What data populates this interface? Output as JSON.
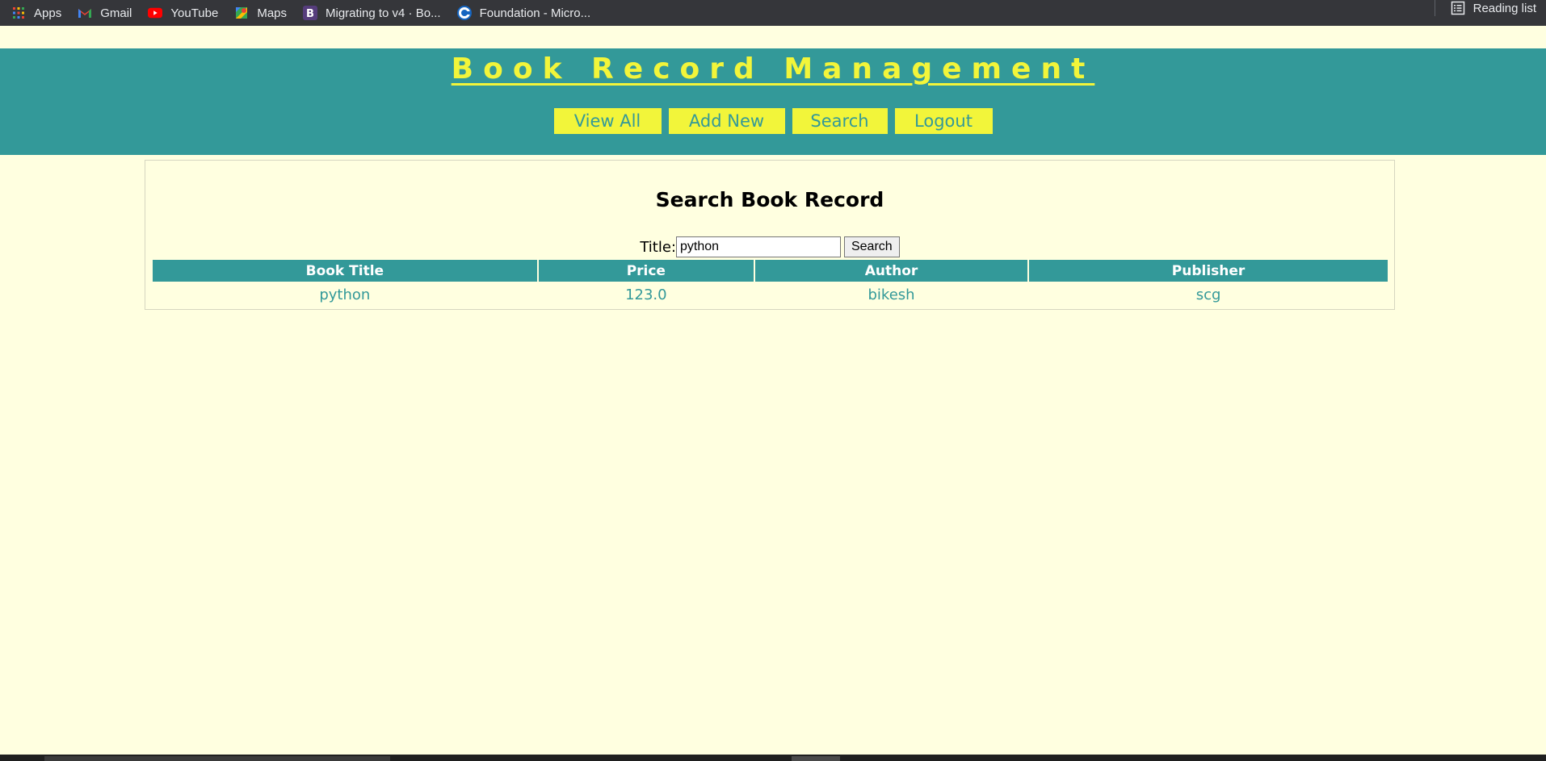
{
  "bookmarks": [
    {
      "label": "Apps",
      "icon": "apps-grid-icon"
    },
    {
      "label": "Gmail",
      "icon": "gmail-icon"
    },
    {
      "label": "YouTube",
      "icon": "youtube-icon"
    },
    {
      "label": "Maps",
      "icon": "maps-icon"
    },
    {
      "label": "Migrating to v4 · Bo...",
      "icon": "bootstrap-icon"
    },
    {
      "label": "Foundation - Micro...",
      "icon": "foundation-icon"
    }
  ],
  "reading_list": "Reading list",
  "header": {
    "title": "Book Record Management",
    "nav": [
      "View All",
      "Add New",
      "Search",
      "Logout"
    ]
  },
  "main": {
    "heading": "Search Book Record",
    "search": {
      "label": "Title:",
      "value": "python",
      "button": "Search"
    },
    "table": {
      "columns": [
        "Book Title",
        "Price",
        "Author",
        "Publisher"
      ],
      "rows": [
        [
          "python",
          "123.0",
          "bikesh",
          "scg"
        ]
      ]
    }
  },
  "colors": {
    "accent": "#339999",
    "highlight": "#f2f53a",
    "background": "#ffffe0"
  }
}
